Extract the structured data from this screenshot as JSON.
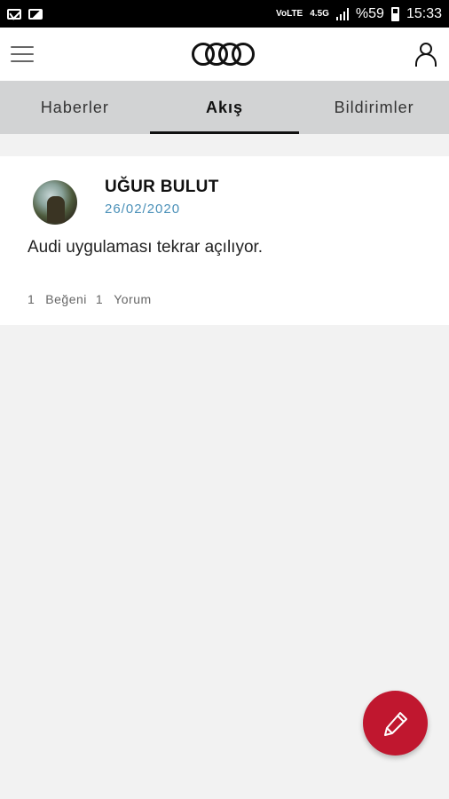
{
  "status_bar": {
    "battery_percent": "%59",
    "time": "15:33",
    "network_label": "4.5G",
    "volte_label": "VoLTE",
    "icons": [
      "mail-icon",
      "image-icon",
      "alarm-icon",
      "mute-icon",
      "signal-icon",
      "battery-icon"
    ]
  },
  "app_bar": {
    "logo_icon": "audi-rings-logo",
    "menu_icon": "hamburger-menu-icon",
    "profile_icon": "user-icon"
  },
  "tabs": [
    {
      "label": "Haberler",
      "active": false
    },
    {
      "label": "Akış",
      "active": true
    },
    {
      "label": "Bildirimler",
      "active": false
    }
  ],
  "feed": {
    "posts": [
      {
        "author": "UĞUR BULUT",
        "date": "26/02/2020",
        "text": "Audi uygulaması tekrar açılıyor.",
        "likes_count": "1",
        "likes_label": "Beğeni",
        "comments_count": "1",
        "comments_label": "Yorum"
      }
    ]
  },
  "fab": {
    "icon": "pencil-icon",
    "color": "#c0172f"
  },
  "colors": {
    "accent": "#c0172f",
    "date": "#4a90b8",
    "tab_bar": "#d2d3d4",
    "background": "#f2f2f2"
  }
}
